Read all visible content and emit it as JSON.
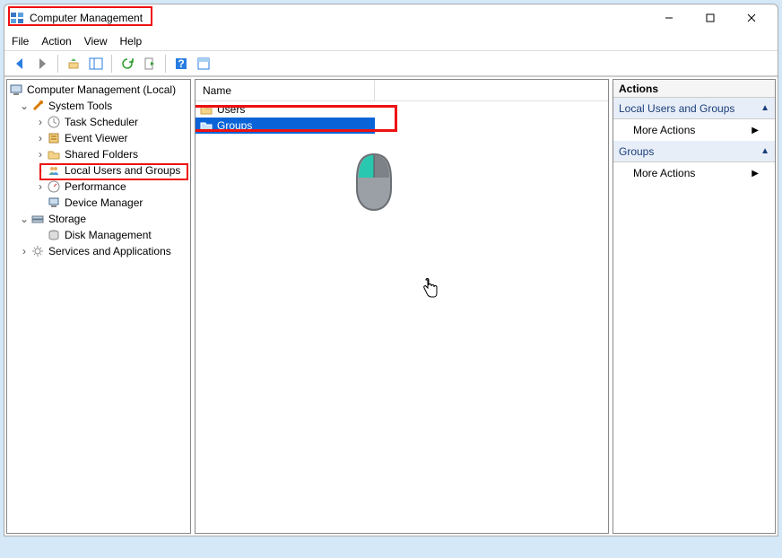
{
  "title": "Computer Management",
  "menu": {
    "file": "File",
    "action": "Action",
    "view": "View",
    "help": "Help"
  },
  "tree": {
    "root": "Computer Management (Local)",
    "system_tools": "System Tools",
    "task_scheduler": "Task Scheduler",
    "event_viewer": "Event Viewer",
    "shared_folders": "Shared Folders",
    "local_users_groups": "Local Users and Groups",
    "performance": "Performance",
    "device_manager": "Device Manager",
    "storage": "Storage",
    "disk_management": "Disk Management",
    "services_apps": "Services and Applications"
  },
  "list": {
    "col_name": "Name",
    "users": "Users",
    "groups": "Groups"
  },
  "actions": {
    "header": "Actions",
    "section1": "Local Users and Groups",
    "section2": "Groups",
    "more": "More Actions"
  }
}
